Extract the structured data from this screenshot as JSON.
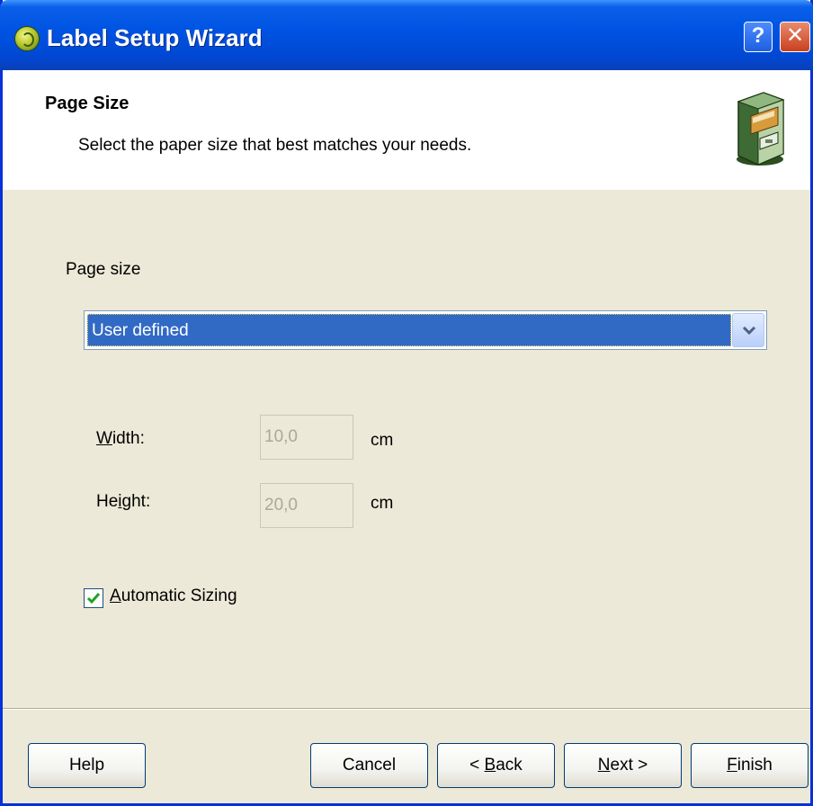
{
  "window": {
    "title": "Label Setup Wizard",
    "help_glyph": "?",
    "close_glyph": "✕"
  },
  "header": {
    "title": "Page Size",
    "subtitle": "Select the paper size that best matches your needs.",
    "icon": "file-cabinet-icon"
  },
  "form": {
    "page_size_label": "Page size",
    "page_size_value": "User defined",
    "width_label_pre": "W",
    "width_label_post": "idth:",
    "width_value": "10,0",
    "width_unit": "cm",
    "height_label_pre": "He",
    "height_label_ul": "i",
    "height_label_post": "ght:",
    "height_value": "20,0",
    "height_unit": "cm",
    "auto_sizing_ul": "A",
    "auto_sizing_rest": "utomatic Sizing",
    "auto_sizing_checked": true
  },
  "buttons": {
    "help": "Help",
    "cancel": "Cancel",
    "back_prefix": "< ",
    "back_ul": "B",
    "back_rest": "ack",
    "next_ul": "N",
    "next_rest": "ext >",
    "finish_ul": "F",
    "finish_rest": "inish"
  },
  "colors": {
    "titlebar": "#0054e3",
    "selection": "#316ac5",
    "dialog_bg": "#ece9d8"
  }
}
